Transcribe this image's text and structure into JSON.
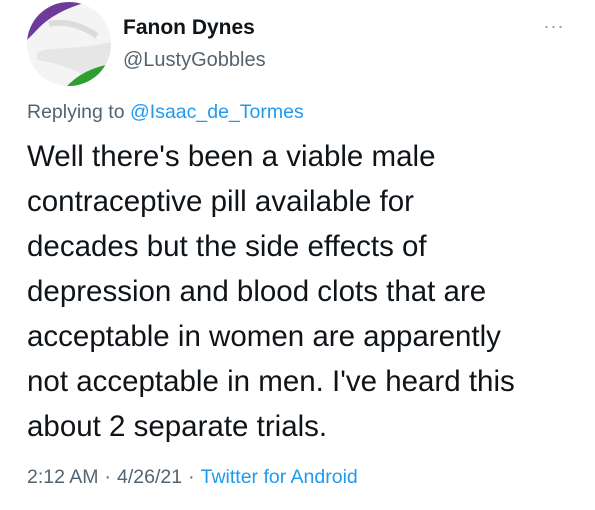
{
  "user": {
    "display_name": "Fanon Dynes",
    "handle": "@LustyGobbles",
    "avatar_colors": [
      "#6f3b9b",
      "#2e9f2f",
      "#f4f4f4"
    ]
  },
  "more_icon": "more-dots-icon",
  "more_glyph": "···",
  "reply": {
    "prefix": "Replying to",
    "handle": "@Isaac_de_Tormes"
  },
  "tweet": {
    "text": "Well there's been a viable male\ncontraceptive pill available for\ndecades but the side effects of\ndepression and blood clots that are\nacceptable in women are apparently\nnot acceptable in men. I've heard this\nabout 2 separate trials."
  },
  "meta": {
    "time": "2:12 AM",
    "separator": "·",
    "date": "4/26/21",
    "source": "Twitter for Android"
  },
  "colors": {
    "link": "#1d9bf0",
    "secondary": "#536471",
    "text": "#0f1419"
  }
}
